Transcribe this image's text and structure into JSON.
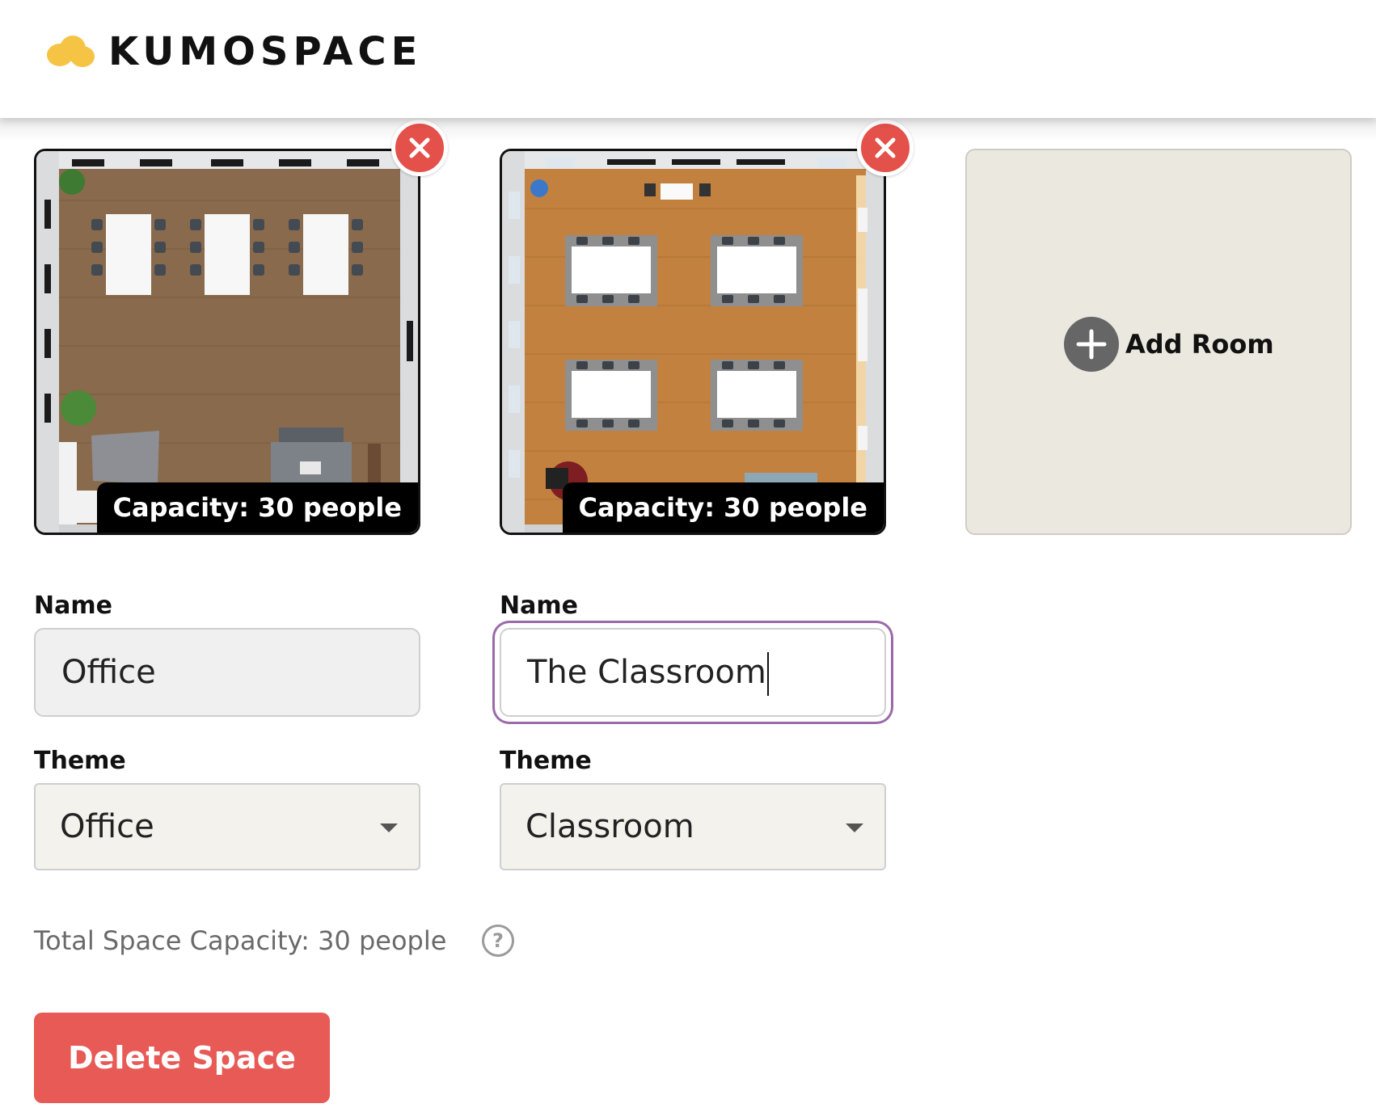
{
  "header": {
    "brand": "KUMOSPACE",
    "logo_icon": "cloud-icon",
    "logo_color": "#f6c445"
  },
  "rooms": [
    {
      "capacity_label": "Capacity: 30 people",
      "name_label": "Name",
      "name_value": "Office",
      "theme_label": "Theme",
      "theme_value": "Office"
    },
    {
      "capacity_label": "Capacity: 30 people",
      "name_label": "Name",
      "name_value": "The Classroom",
      "theme_label": "Theme",
      "theme_value": "Classroom"
    }
  ],
  "add_room": {
    "label": "Add Room",
    "icon": "plus-icon"
  },
  "total_capacity": "Total Space Capacity: 30 people",
  "help_icon": "?",
  "delete_button": "Delete Space",
  "colors": {
    "danger": "#e85a55",
    "remove": "#e4504a",
    "focus": "#9b6aa8"
  }
}
